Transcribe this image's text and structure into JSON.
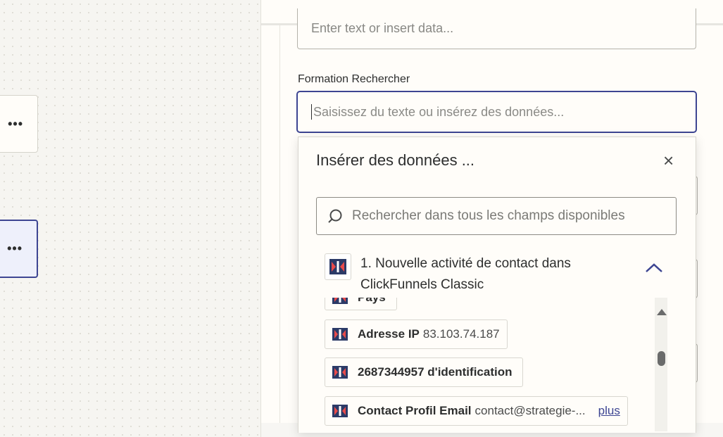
{
  "colors": {
    "accent": "#3d4592",
    "text": "#2d2e2e",
    "placeholder": "#888884",
    "canvas": "#f6f5f1"
  },
  "canvas": {
    "nodes": [
      {
        "menu_label": "•••"
      },
      {
        "menu_label": "•••"
      }
    ]
  },
  "form": {
    "top_field_placeholder": "Enter text or insert data...",
    "search_field_label": "Formation Rechercher",
    "search_field_placeholder": "Saisissez du texte ou insérez des données..."
  },
  "insert_data": {
    "title": "Insérer des données ...",
    "close_icon": "close-icon",
    "close_glyph": "×",
    "search_placeholder": "Rechercher dans tous les champs disponibles",
    "group_title": "1. Nouvelle activité de contact dans ClickFunnels Classic",
    "items": [
      {
        "key": "Pays",
        "value": ""
      },
      {
        "key": "Adresse IP",
        "value": "83.103.74.187"
      },
      {
        "key": "2687344957 d'identification",
        "value": ""
      },
      {
        "key": "Contact Profil Email",
        "value": "contact@strategie-...",
        "more": "plus"
      }
    ]
  }
}
